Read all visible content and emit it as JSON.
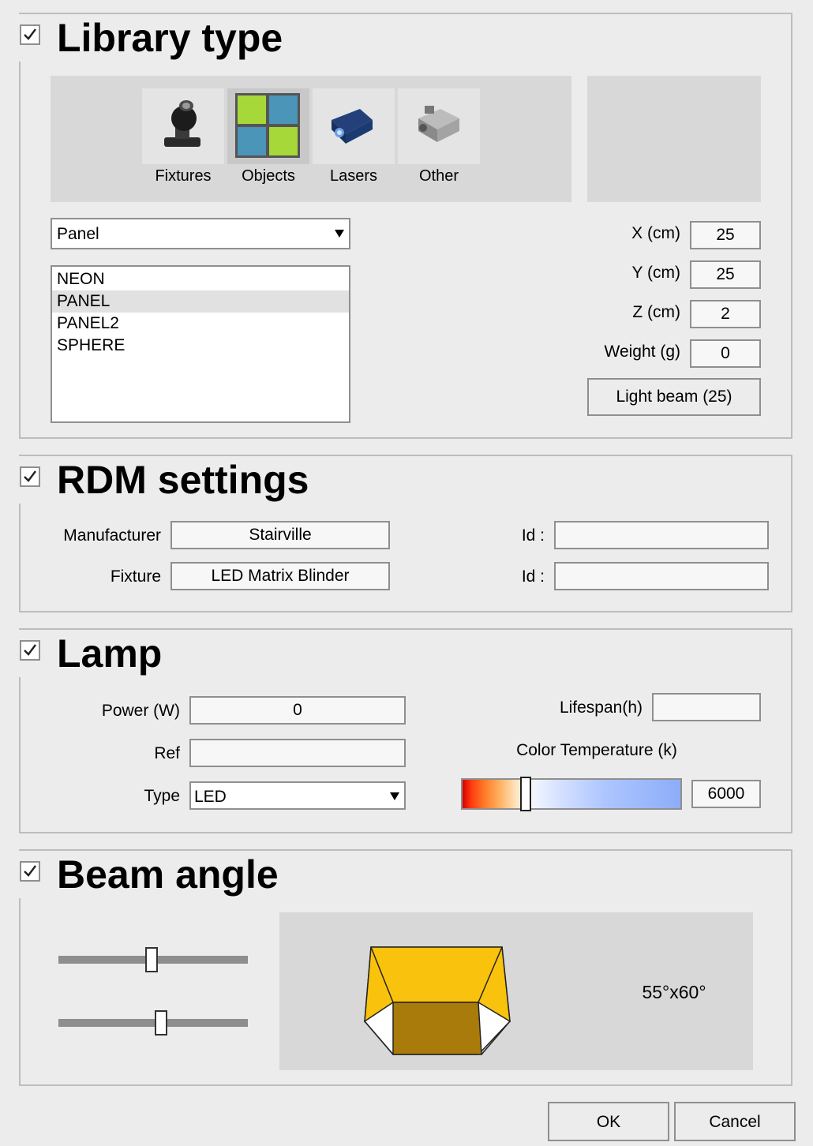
{
  "library": {
    "title": "Library type",
    "checked": true,
    "tiles": [
      {
        "label": "Fixtures",
        "icon": "moving-head-fixture-icon",
        "selected": false
      },
      {
        "label": "Objects",
        "icon": "objects-panel-icon",
        "selected": true
      },
      {
        "label": "Lasers",
        "icon": "laser-icon",
        "selected": false
      },
      {
        "label": "Other",
        "icon": "smoke-machine-icon",
        "selected": false
      }
    ],
    "category_select": "Panel",
    "items": [
      "NEON",
      "PANEL",
      "PANEL2",
      "SPHERE"
    ],
    "selected_item": "PANEL",
    "x_label": "X (cm)",
    "x_value": "25",
    "y_label": "Y (cm)",
    "y_value": "25",
    "z_label": "Z (cm)",
    "z_value": "2",
    "weight_label": "Weight (g)",
    "weight_value": "0",
    "light_beam_button": "Light beam (25)"
  },
  "rdm": {
    "title": "RDM settings",
    "checked": true,
    "manufacturer_label": "Manufacturer",
    "manufacturer_value": "Stairville",
    "fixture_label": "Fixture",
    "fixture_value": "LED Matrix Blinder",
    "id_label_1": "Id :",
    "id_value_1": "",
    "id_label_2": "Id :",
    "id_value_2": ""
  },
  "lamp": {
    "title": "Lamp",
    "checked": true,
    "power_label": "Power (W)",
    "power_value": "0",
    "ref_label": "Ref",
    "ref_value": "",
    "type_label": "Type",
    "type_value": "LED",
    "lifespan_label": "Lifespan(h)",
    "lifespan_value": "",
    "color_temp_label": "Color Temperature (k)",
    "color_temp_value": "6000",
    "color_temp_slider_fraction": 0.29
  },
  "beam": {
    "title": "Beam angle",
    "checked": true,
    "slider1_fraction": 0.49,
    "slider2_fraction": 0.54,
    "angle_text": "55°x60°",
    "beam_colors": {
      "outer": "#f9c20c",
      "inner": "#a87b0a"
    }
  },
  "footer": {
    "ok_label": "OK",
    "cancel_label": "Cancel"
  }
}
